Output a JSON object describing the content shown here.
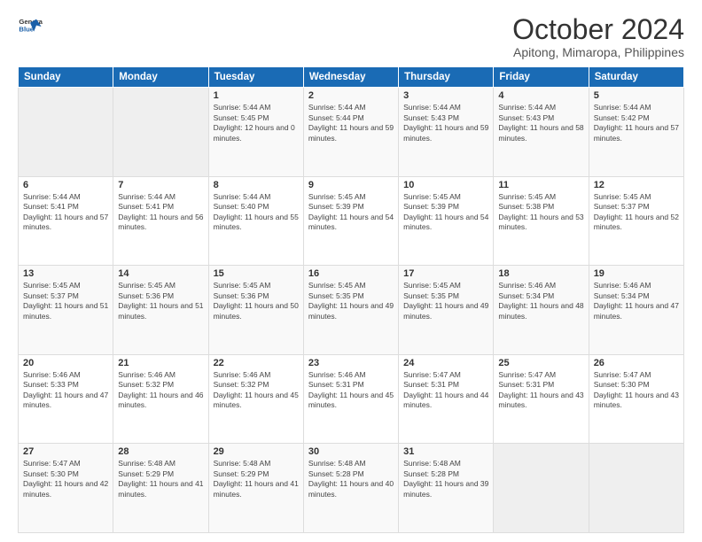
{
  "header": {
    "logo_line1": "General",
    "logo_line2": "Blue",
    "title": "October 2024",
    "subtitle": "Apitong, Mimaropa, Philippines"
  },
  "weekdays": [
    "Sunday",
    "Monday",
    "Tuesday",
    "Wednesday",
    "Thursday",
    "Friday",
    "Saturday"
  ],
  "weeks": [
    [
      {
        "day": "",
        "sunrise": "",
        "sunset": "",
        "daylight": "",
        "empty": true
      },
      {
        "day": "",
        "sunrise": "",
        "sunset": "",
        "daylight": "",
        "empty": true
      },
      {
        "day": "1",
        "sunrise": "Sunrise: 5:44 AM",
        "sunset": "Sunset: 5:45 PM",
        "daylight": "Daylight: 12 hours and 0 minutes.",
        "empty": false
      },
      {
        "day": "2",
        "sunrise": "Sunrise: 5:44 AM",
        "sunset": "Sunset: 5:44 PM",
        "daylight": "Daylight: 11 hours and 59 minutes.",
        "empty": false
      },
      {
        "day": "3",
        "sunrise": "Sunrise: 5:44 AM",
        "sunset": "Sunset: 5:43 PM",
        "daylight": "Daylight: 11 hours and 59 minutes.",
        "empty": false
      },
      {
        "day": "4",
        "sunrise": "Sunrise: 5:44 AM",
        "sunset": "Sunset: 5:43 PM",
        "daylight": "Daylight: 11 hours and 58 minutes.",
        "empty": false
      },
      {
        "day": "5",
        "sunrise": "Sunrise: 5:44 AM",
        "sunset": "Sunset: 5:42 PM",
        "daylight": "Daylight: 11 hours and 57 minutes.",
        "empty": false
      }
    ],
    [
      {
        "day": "6",
        "sunrise": "Sunrise: 5:44 AM",
        "sunset": "Sunset: 5:41 PM",
        "daylight": "Daylight: 11 hours and 57 minutes.",
        "empty": false
      },
      {
        "day": "7",
        "sunrise": "Sunrise: 5:44 AM",
        "sunset": "Sunset: 5:41 PM",
        "daylight": "Daylight: 11 hours and 56 minutes.",
        "empty": false
      },
      {
        "day": "8",
        "sunrise": "Sunrise: 5:44 AM",
        "sunset": "Sunset: 5:40 PM",
        "daylight": "Daylight: 11 hours and 55 minutes.",
        "empty": false
      },
      {
        "day": "9",
        "sunrise": "Sunrise: 5:45 AM",
        "sunset": "Sunset: 5:39 PM",
        "daylight": "Daylight: 11 hours and 54 minutes.",
        "empty": false
      },
      {
        "day": "10",
        "sunrise": "Sunrise: 5:45 AM",
        "sunset": "Sunset: 5:39 PM",
        "daylight": "Daylight: 11 hours and 54 minutes.",
        "empty": false
      },
      {
        "day": "11",
        "sunrise": "Sunrise: 5:45 AM",
        "sunset": "Sunset: 5:38 PM",
        "daylight": "Daylight: 11 hours and 53 minutes.",
        "empty": false
      },
      {
        "day": "12",
        "sunrise": "Sunrise: 5:45 AM",
        "sunset": "Sunset: 5:37 PM",
        "daylight": "Daylight: 11 hours and 52 minutes.",
        "empty": false
      }
    ],
    [
      {
        "day": "13",
        "sunrise": "Sunrise: 5:45 AM",
        "sunset": "Sunset: 5:37 PM",
        "daylight": "Daylight: 11 hours and 51 minutes.",
        "empty": false
      },
      {
        "day": "14",
        "sunrise": "Sunrise: 5:45 AM",
        "sunset": "Sunset: 5:36 PM",
        "daylight": "Daylight: 11 hours and 51 minutes.",
        "empty": false
      },
      {
        "day": "15",
        "sunrise": "Sunrise: 5:45 AM",
        "sunset": "Sunset: 5:36 PM",
        "daylight": "Daylight: 11 hours and 50 minutes.",
        "empty": false
      },
      {
        "day": "16",
        "sunrise": "Sunrise: 5:45 AM",
        "sunset": "Sunset: 5:35 PM",
        "daylight": "Daylight: 11 hours and 49 minutes.",
        "empty": false
      },
      {
        "day": "17",
        "sunrise": "Sunrise: 5:45 AM",
        "sunset": "Sunset: 5:35 PM",
        "daylight": "Daylight: 11 hours and 49 minutes.",
        "empty": false
      },
      {
        "day": "18",
        "sunrise": "Sunrise: 5:46 AM",
        "sunset": "Sunset: 5:34 PM",
        "daylight": "Daylight: 11 hours and 48 minutes.",
        "empty": false
      },
      {
        "day": "19",
        "sunrise": "Sunrise: 5:46 AM",
        "sunset": "Sunset: 5:34 PM",
        "daylight": "Daylight: 11 hours and 47 minutes.",
        "empty": false
      }
    ],
    [
      {
        "day": "20",
        "sunrise": "Sunrise: 5:46 AM",
        "sunset": "Sunset: 5:33 PM",
        "daylight": "Daylight: 11 hours and 47 minutes.",
        "empty": false
      },
      {
        "day": "21",
        "sunrise": "Sunrise: 5:46 AM",
        "sunset": "Sunset: 5:32 PM",
        "daylight": "Daylight: 11 hours and 46 minutes.",
        "empty": false
      },
      {
        "day": "22",
        "sunrise": "Sunrise: 5:46 AM",
        "sunset": "Sunset: 5:32 PM",
        "daylight": "Daylight: 11 hours and 45 minutes.",
        "empty": false
      },
      {
        "day": "23",
        "sunrise": "Sunrise: 5:46 AM",
        "sunset": "Sunset: 5:31 PM",
        "daylight": "Daylight: 11 hours and 45 minutes.",
        "empty": false
      },
      {
        "day": "24",
        "sunrise": "Sunrise: 5:47 AM",
        "sunset": "Sunset: 5:31 PM",
        "daylight": "Daylight: 11 hours and 44 minutes.",
        "empty": false
      },
      {
        "day": "25",
        "sunrise": "Sunrise: 5:47 AM",
        "sunset": "Sunset: 5:31 PM",
        "daylight": "Daylight: 11 hours and 43 minutes.",
        "empty": false
      },
      {
        "day": "26",
        "sunrise": "Sunrise: 5:47 AM",
        "sunset": "Sunset: 5:30 PM",
        "daylight": "Daylight: 11 hours and 43 minutes.",
        "empty": false
      }
    ],
    [
      {
        "day": "27",
        "sunrise": "Sunrise: 5:47 AM",
        "sunset": "Sunset: 5:30 PM",
        "daylight": "Daylight: 11 hours and 42 minutes.",
        "empty": false
      },
      {
        "day": "28",
        "sunrise": "Sunrise: 5:48 AM",
        "sunset": "Sunset: 5:29 PM",
        "daylight": "Daylight: 11 hours and 41 minutes.",
        "empty": false
      },
      {
        "day": "29",
        "sunrise": "Sunrise: 5:48 AM",
        "sunset": "Sunset: 5:29 PM",
        "daylight": "Daylight: 11 hours and 41 minutes.",
        "empty": false
      },
      {
        "day": "30",
        "sunrise": "Sunrise: 5:48 AM",
        "sunset": "Sunset: 5:28 PM",
        "daylight": "Daylight: 11 hours and 40 minutes.",
        "empty": false
      },
      {
        "day": "31",
        "sunrise": "Sunrise: 5:48 AM",
        "sunset": "Sunset: 5:28 PM",
        "daylight": "Daylight: 11 hours and 39 minutes.",
        "empty": false
      },
      {
        "day": "",
        "sunrise": "",
        "sunset": "",
        "daylight": "",
        "empty": true
      },
      {
        "day": "",
        "sunrise": "",
        "sunset": "",
        "daylight": "",
        "empty": true
      }
    ]
  ]
}
